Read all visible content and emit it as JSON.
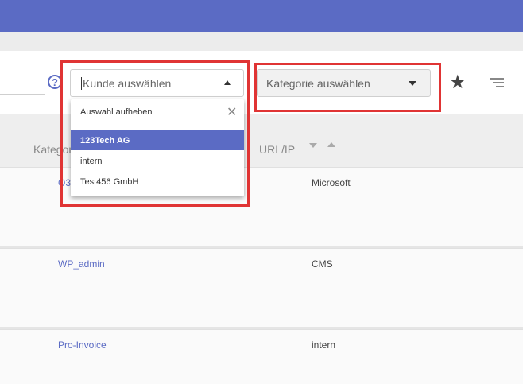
{
  "toolbar": {
    "help_icon": "?",
    "customer_select": {
      "placeholder": "Kunde auswählen"
    },
    "category_select": {
      "placeholder": "Kategorie auswählen"
    },
    "star_icon": "★"
  },
  "table": {
    "headers": {
      "category": "Kategorie",
      "url": "URL/IP"
    },
    "rows": [
      {
        "name": "O365",
        "url": "Microsoft"
      },
      {
        "name": "WP_admin",
        "url": "CMS"
      },
      {
        "name": "Pro-Invoice",
        "url": "intern"
      }
    ]
  },
  "dropdown": {
    "clear_label": "Auswahl aufheben",
    "close_icon": "✕",
    "options": [
      {
        "label": "123Tech AG"
      },
      {
        "label": "intern"
      },
      {
        "label": "Test456 GmbH"
      }
    ]
  },
  "colors": {
    "accent": "#5b6bc4",
    "highlight": "#e03434"
  }
}
